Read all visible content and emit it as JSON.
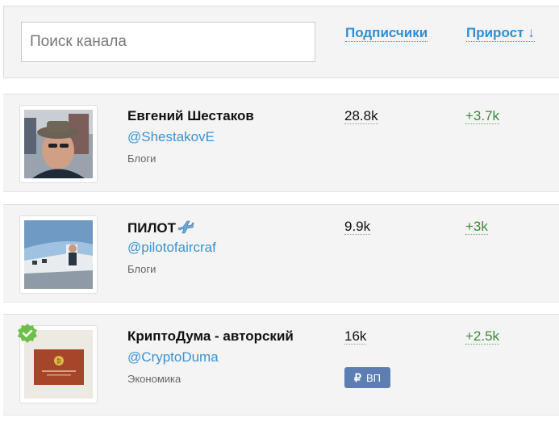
{
  "search": {
    "placeholder": "Поиск канала"
  },
  "columns": {
    "subscribers_label": "Подписчики",
    "growth_label": "Прирост",
    "growth_sort_arrow": "↓"
  },
  "channels": [
    {
      "name": "Евгений Шестаков",
      "handle": "@ShestakovE",
      "category": "Блоги",
      "subscribers": "28.8k",
      "growth": "+3.7k"
    },
    {
      "name": "ПИЛОТ",
      "name_emoji": "airplane-icon",
      "handle": "@pilotofaircraf",
      "category": "Блоги",
      "subscribers": "9.9k",
      "growth": "+3k"
    },
    {
      "name": "КриптоДума - авторский",
      "handle": "@CryptoDuma",
      "category": "Экономика",
      "subscribers": "16k",
      "growth": "+2.5k",
      "verified": true,
      "badge": {
        "icon": "₽",
        "label": "ВП"
      }
    }
  ],
  "colors": {
    "link": "#2f8fd6",
    "growth": "#3c8a3c",
    "badge": "#5d7eb3",
    "verified": "#6cc04a"
  }
}
